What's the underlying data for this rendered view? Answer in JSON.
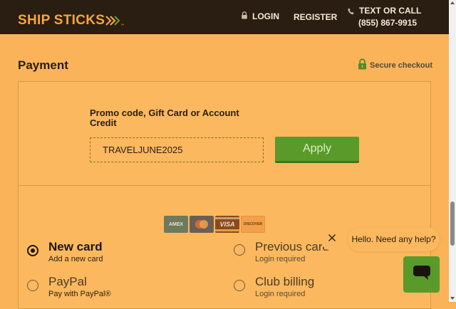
{
  "header": {
    "logo": "SHIP STICKS",
    "logo_tm": "™",
    "login": "LOGIN",
    "register": "REGISTER",
    "call_label": "TEXT OR CALL",
    "phone": "(855) 867-9915"
  },
  "payment": {
    "title": "Payment",
    "secure": "Secure checkout"
  },
  "promo": {
    "label": "Promo code, Gift Card or Account Credit",
    "value": "TRAVELJUNE2025",
    "apply": "Apply"
  },
  "cards": {
    "amex": "AMEX",
    "visa": "VISA",
    "discover": "DISCOVER"
  },
  "options": {
    "new_card": {
      "title": "New card",
      "sub": "Add a new card",
      "selected": true
    },
    "previous_card": {
      "title": "Previous card",
      "sub": "Login required",
      "selected": false
    },
    "paypal": {
      "title": "PayPal",
      "sub": "Pay with PayPal®",
      "selected": false
    },
    "club_billing": {
      "title": "Club billing",
      "sub": "Login required",
      "selected": false
    }
  },
  "chat": {
    "greeting": "Hello. Need any help?"
  },
  "icons": {
    "login": "lock-icon",
    "call": "phone-icon",
    "secure": "padlock-icon",
    "close": "close-icon",
    "chat": "chat-icon"
  },
  "colors": {
    "header_bg": "#2a1d12",
    "brand_orange": "#f6a63c",
    "page_bg": "#fab358",
    "apply_green": "#5a9a2a"
  }
}
